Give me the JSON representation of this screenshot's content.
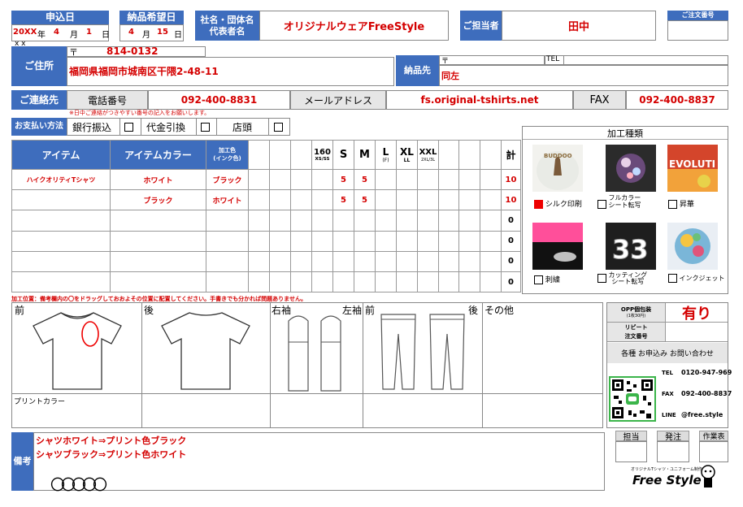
{
  "header": {
    "apply_date_label": "申込日",
    "apply_year": "20XX",
    "apply_year_unit": "年",
    "apply_month": "4",
    "apply_month_unit": "月",
    "apply_day": "1",
    "apply_day_unit": "日",
    "apply_year_sub": "x x",
    "delivery_label": "納品希望日",
    "delivery_month": "4",
    "delivery_month_unit": "月",
    "delivery_day": "15",
    "delivery_day_unit": "日",
    "company_label": "社名・団体名\n代表者名",
    "company_value": "オリジナルウェアFreeStyle",
    "staff_label": "ご担当者",
    "staff_value": "田中",
    "order_no_label": "ご注文番号"
  },
  "address": {
    "label": "ご住所",
    "postal_mark": "〒",
    "postal_code": "814-0132",
    "value": "福岡県福岡市城南区干隈2-48-11",
    "delivery_label": "納品先",
    "delivery_postal_mark": "〒",
    "tel_label": "TEL",
    "delivery_value": "同左"
  },
  "contact": {
    "label": "ご連絡先",
    "phone_label": "電話番号",
    "phone_value": "092-400-8831",
    "mail_label": "メールアドレス",
    "mail_value": "fs.original-tshirts.net",
    "fax_label": "FAX",
    "fax_value": "092-400-8837",
    "note": "※日中ご連絡がつきやすい番号の記入をお願いします。"
  },
  "payment": {
    "label": "お支払い方法",
    "options": [
      "銀行振込",
      "代金引換",
      "店頭"
    ]
  },
  "items": {
    "headers": {
      "item": "アイテム",
      "color": "アイテムカラー",
      "ink": "加工色\n(インク色)",
      "total": "計"
    },
    "sizes": [
      {
        "main": "160",
        "sub": "XS/SS"
      },
      {
        "main": "S",
        "sub": ""
      },
      {
        "main": "M",
        "sub": ""
      },
      {
        "main": "L",
        "sub": "(F)"
      },
      {
        "main": "XL",
        "sub": "LL"
      },
      {
        "main": "XXL",
        "sub": "2XL/3L"
      }
    ],
    "rows": [
      {
        "item": "ハイクオリティTシャツ",
        "color": "ホワイト",
        "ink": "ブラック",
        "s": "5",
        "m": "5",
        "total": "10"
      },
      {
        "item": "",
        "color": "ブラック",
        "ink": "ホワイト",
        "s": "5",
        "m": "5",
        "total": "10"
      },
      {
        "item": "",
        "color": "",
        "ink": "",
        "s": "",
        "m": "",
        "total": "0"
      },
      {
        "item": "",
        "color": "",
        "ink": "",
        "s": "",
        "m": "",
        "total": "0"
      },
      {
        "item": "",
        "color": "",
        "ink": "",
        "s": "",
        "m": "",
        "total": "0"
      },
      {
        "item": "",
        "color": "",
        "ink": "",
        "s": "",
        "m": "",
        "total": "0"
      }
    ]
  },
  "processing": {
    "title": "加工種類",
    "types": [
      "シルク印刷",
      "フルカラー\nシート転写",
      "昇華",
      "刺繍",
      "カッティング\nシート転写",
      "インクジェット"
    ]
  },
  "position": {
    "note": "加工位置：備考欄内の〇をドラッグしておおよその位置に配置してください。手書きでも分かれば問題ありません。",
    "front": "前",
    "back": "後",
    "right_sleeve": "右袖",
    "left_sleeve": "左袖",
    "pants_front": "前",
    "pants_back": "後",
    "other": "その他",
    "print_color": "プリントカラー"
  },
  "side": {
    "opp_label": "OPP個包装",
    "opp_sub": "(1枚30円)",
    "opp_value": "有り",
    "repeat_label": "リピート\n注文番号",
    "inquiry": "各種 お申込み お問い合わせ",
    "tel_label": "TEL",
    "tel_value": "0120-947-969",
    "fax_label": "FAX",
    "fax_value": "092-400-8837",
    "line_label": "LINE",
    "line_value": "@free.style"
  },
  "remarks": {
    "label": "備考",
    "line1": "シャツホワイト⇒プリント色ブラック",
    "line2": "シャツブラック⇒プリント色ホワイト",
    "circles": "〇〇〇〇〇"
  },
  "stamps": [
    "担当",
    "発注",
    "作業表"
  ],
  "brand": {
    "tagline": "オリジナルTシャツ・ユニフォーム制作",
    "name": "Free Style"
  }
}
